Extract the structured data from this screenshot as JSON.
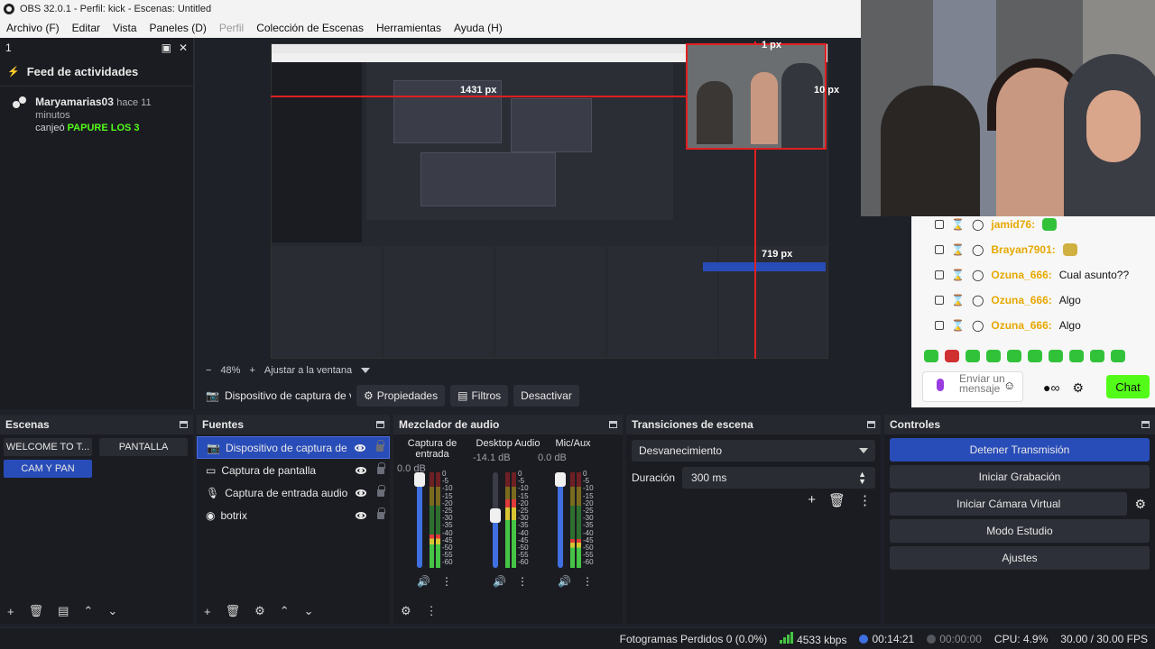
{
  "window": {
    "title": "OBS 32.0.1 - Perfil: kick - Escenas: Untitled"
  },
  "menu": [
    "Archivo (F)",
    "Editar",
    "Vista",
    "Paneles (D)",
    "Perfil",
    "Colección de Escenas",
    "Herramientas",
    "Ayuda (H)"
  ],
  "activity_dock": {
    "tab_label": "1",
    "title": "Feed de actividades",
    "items": [
      {
        "user": "Maryamarias03",
        "time": "hace 11 minutos",
        "action": "canjeó",
        "reward": "PAPURE LOS 3"
      }
    ]
  },
  "preview": {
    "labels": {
      "top": "1 px",
      "left": "1431 px",
      "right": "10 px",
      "bottom": "719 px"
    },
    "nested": {
      "open_label": "Enviar un mensaje"
    }
  },
  "zoom": {
    "minus": "−",
    "value": "48%",
    "plus": "+",
    "fit_label": "Ajustar a la ventana"
  },
  "source_toolbar": {
    "selected_source": "Dispositivo de captura de vídeo",
    "properties": "Propiedades",
    "filters": "Filtros",
    "deactivate": "Desactivar"
  },
  "chat": {
    "messages": [
      {
        "user": "jamid76:",
        "text": ""
      },
      {
        "user": "Brayan7901:",
        "text": ""
      },
      {
        "user": "Ozuna_666:",
        "text": "Cual asunto??"
      },
      {
        "user": "Ozuna_666:",
        "text": "Algo"
      },
      {
        "user": "Ozuna_666:",
        "text": "Algo"
      }
    ],
    "input_placeholder": "Enviar un mensaje",
    "send_label": "Chat"
  },
  "scenes": {
    "title": "Escenas",
    "items": [
      {
        "label": "WELCOME TO T...",
        "selected": false
      },
      {
        "label": "PANTALLA",
        "selected": false
      },
      {
        "label": "CAM Y PAN",
        "selected": true
      }
    ]
  },
  "sources": {
    "title": "Fuentes",
    "items": [
      {
        "label": "Dispositivo de captura de vídeo",
        "icon": "camera-icon",
        "selected": true
      },
      {
        "label": "Captura de pantalla",
        "icon": "monitor-icon",
        "selected": false
      },
      {
        "label": "Captura de entrada audio",
        "icon": "microphone-icon",
        "selected": false
      },
      {
        "label": "botrix",
        "icon": "browser-icon",
        "selected": false
      }
    ]
  },
  "mixer": {
    "title": "Mezclador de audio",
    "channels": [
      {
        "name": "Captura de entrada",
        "db": "0.0 dB",
        "level": 0.92,
        "meter": 0.35
      },
      {
        "name": "Desktop Audio",
        "db": "-14.1 dB",
        "level": 0.55,
        "meter": 0.72
      },
      {
        "name": "Mic/Aux",
        "db": "0.0 dB",
        "level": 0.92,
        "meter": 0.3
      }
    ],
    "scale": [
      "0",
      "-5",
      "-10",
      "-15",
      "-20",
      "-25",
      "-30",
      "-35",
      "-40",
      "-45",
      "-50",
      "-55",
      "-60"
    ]
  },
  "transitions": {
    "title": "Transiciones de escena",
    "selected": "Desvanecimiento",
    "duration_label": "Duración",
    "duration_value": "300 ms"
  },
  "controls": {
    "title": "Controles",
    "buttons": [
      "Detener Transmisión",
      "Iniciar Grabación",
      "Iniciar Cámara Virtual",
      "Modo Estudio",
      "Ajustes"
    ]
  },
  "status": {
    "dropped": "Fotogramas Perdidos 0 (0.0%)",
    "bitrate": "4533 kbps",
    "stream_time": "00:14:21",
    "rec_time": "00:00:00",
    "cpu": "CPU: 4.9%",
    "fps": "30.00 / 30.00 FPS"
  },
  "colors": {
    "accent": "#284cb8",
    "kick_green": "#53fc18",
    "live": "#3f6fe0",
    "guide": "#e02020"
  }
}
